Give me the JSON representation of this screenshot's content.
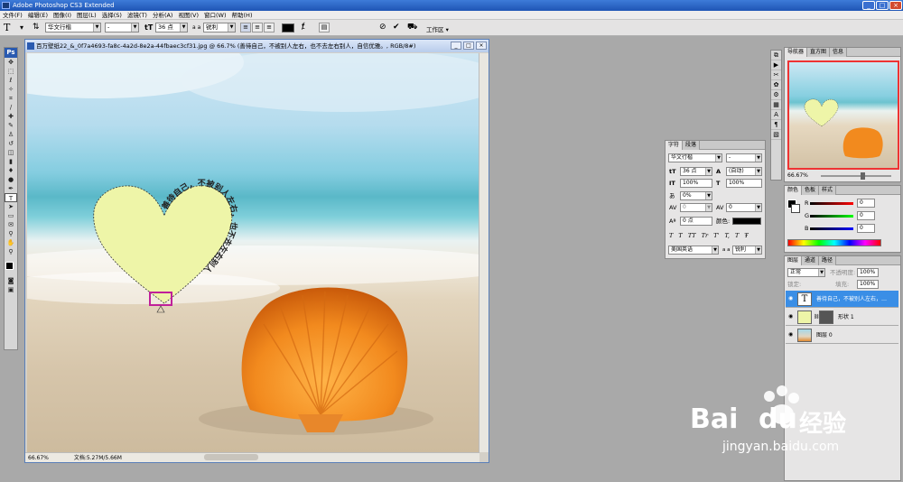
{
  "app": {
    "title": "Adobe Photoshop CS3 Extended",
    "ps_logo": "Ps"
  },
  "menu": [
    "文件(F)",
    "编辑(E)",
    "图像(I)",
    "图层(L)",
    "选择(S)",
    "滤镜(T)",
    "分析(A)",
    "视图(V)",
    "窗口(W)",
    "帮助(H)"
  ],
  "options": {
    "font_family": "华文行楷",
    "font_style": "-",
    "font_size": "36 点",
    "aa_label": "a a",
    "aa_mode": "锐利",
    "workspace": "工作区 ▾",
    "text_color": "#000000"
  },
  "document": {
    "title": "百万壁纸22_&_0f7a4693-fa8c-4a2d-8e2a-44fbaec3cf31.jpg @ 66.7% (善待自己，不被别人左右，也不去左右别人，自信优雅。, RGB/8#)",
    "zoom": "66.67%",
    "doc_size": "文档:5.27M/5.66M",
    "heart_text": "善待自己，不被别人左右，也不去左右别人",
    "heart_color": "#eef5a8"
  },
  "character_panel": {
    "tabs": [
      "字符",
      "段落"
    ],
    "font_family": "华文行楷",
    "font_style": "-",
    "size": "36 点",
    "leading": "(自动)",
    "vscale": "100%",
    "hscale": "100%",
    "tracking_pct": "0%",
    "kerning": "0",
    "tracking": "0",
    "baseline": "0 点",
    "color_label": "颜色:",
    "color": "#000000",
    "style_buttons": [
      "T",
      "T",
      "TT",
      "Tr",
      "T'",
      "T,",
      "T",
      "Ŧ"
    ],
    "language": "美国英语",
    "aa_label": "a a",
    "aa_mode": "锐利"
  },
  "navigator": {
    "tabs": [
      "导航器",
      "直方图",
      "信息"
    ],
    "zoom": "66.67%"
  },
  "color_panel": {
    "tabs": [
      "颜色",
      "色板",
      "样式"
    ],
    "r_label": "R",
    "r": "0",
    "g_label": "G",
    "g": "0",
    "b_label": "B",
    "b": "0"
  },
  "layers_panel": {
    "tabs": [
      "图层",
      "通道",
      "路径"
    ],
    "blend": "正常",
    "opacity_label": "不透明度:",
    "opacity": "100%",
    "lock_label": "锁定:",
    "fill_label": "填充:",
    "fill": "100%",
    "layers": [
      {
        "name": "善待自己，不被别人左右，…",
        "type_glyph": "T",
        "selected": true
      },
      {
        "name": "形状 1",
        "selected": false
      },
      {
        "name": "图层 0",
        "selected": false
      }
    ]
  },
  "watermark": {
    "brand": "Bai",
    "brand2": "du",
    "cn": "经验",
    "url": "jingyan.baidu.com"
  }
}
